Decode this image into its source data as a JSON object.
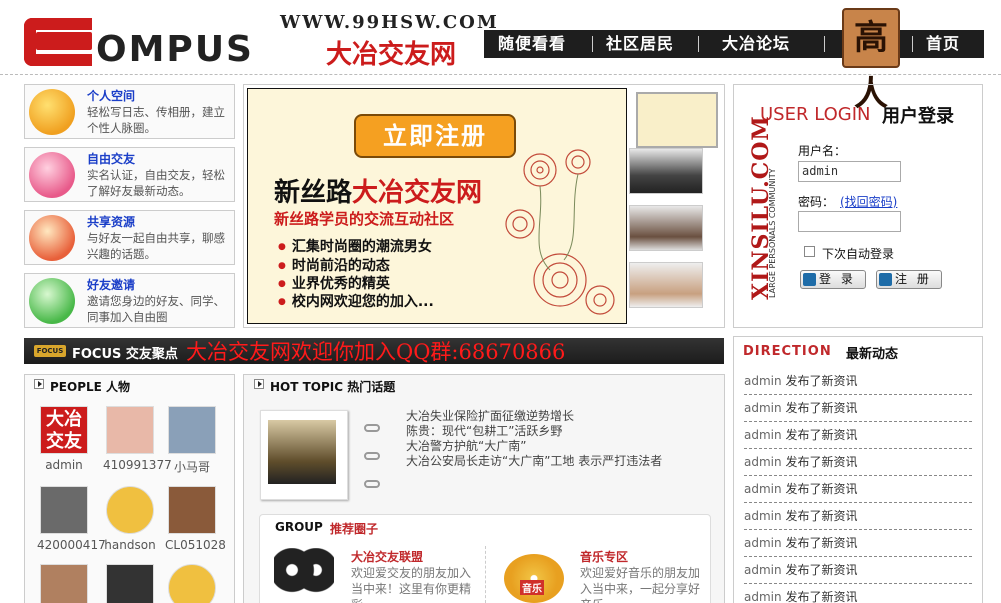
{
  "header": {
    "logo_word": "OMPUS",
    "logo_url": "WWW.99HSW.COM",
    "logo_cn": "大冶交友网",
    "nav": [
      "随便看看",
      "社区居民",
      "大冶论坛",
      "首页"
    ],
    "gaoren_label": "高人"
  },
  "features": [
    {
      "title": "个人空间",
      "desc": "轻松写日志、传相册，建立个性人脉圈。",
      "color": "#f0a020"
    },
    {
      "title": "自由交友",
      "desc": "实名认证，自由交友，轻松了解好友最新动态。",
      "color": "#e85a8a"
    },
    {
      "title": "共享资源",
      "desc": "与好友一起自由共享，聊感兴趣的话题。",
      "color": "#e8603a"
    },
    {
      "title": "好友邀请",
      "desc": "邀请您身边的好友、同学、同事加入自由圈",
      "color": "#48b848"
    }
  ],
  "banner": {
    "register_button": "立即注册",
    "title_black": "新丝路",
    "title_red": "大冶交友网",
    "subtitle": "新丝路学员的交流互动社区",
    "items": [
      "汇集时尚圈的潮流男女",
      "时尚前沿的动态",
      "业界优秀的精英",
      "校内网欢迎您的加入..."
    ]
  },
  "login": {
    "title_en": "USER LOGIN",
    "title_cn": "用户登录",
    "brand": "XINSILU.COM",
    "brand_sub": "LARGE PERSONALS COMMUNITY",
    "username_label": "用户名：",
    "username_value": "admin",
    "password_label": "密码：",
    "forgot_link": "(找回密码)",
    "remember_label": "下次自动登录",
    "login_button": "登 录",
    "register_button": "注 册"
  },
  "focus": {
    "badge": "FOCUS",
    "label": "FOCUS 交友聚点",
    "marquee": "大冶交友网欢迎你加入QQ群:68670866"
  },
  "direction": {
    "title_en": "DIRECTION",
    "title_cn": "最新动态",
    "items": [
      {
        "user": "admin",
        "action": "发布了新资讯"
      },
      {
        "user": "admin",
        "action": "发布了新资讯"
      },
      {
        "user": "admin",
        "action": "发布了新资讯"
      },
      {
        "user": "admin",
        "action": "发布了新资讯"
      },
      {
        "user": "admin",
        "action": "发布了新资讯"
      },
      {
        "user": "admin",
        "action": "发布了新资讯"
      },
      {
        "user": "admin",
        "action": "发布了新资讯"
      },
      {
        "user": "admin",
        "action": "发布了新资讯"
      },
      {
        "user": "admin",
        "action": "发布了新资讯"
      }
    ]
  },
  "people": {
    "title": "PEOPLE 人物",
    "avatar_text": "大冶交友",
    "items": [
      {
        "name": "admin",
        "color": "#cc1c1c"
      },
      {
        "name": "410991377",
        "color": "#e8b8a8"
      },
      {
        "name": "小马哥",
        "color": "#8aa0b8"
      },
      {
        "name": "420000417",
        "color": "#6a6a6a"
      },
      {
        "name": "handson",
        "color": "#f0c040"
      },
      {
        "name": "CL051028",
        "color": "#8a5a3a"
      },
      {
        "name": "",
        "color": "#b08060"
      },
      {
        "name": "",
        "color": "#333333"
      },
      {
        "name": "",
        "color": "#f0c040"
      }
    ]
  },
  "hot": {
    "title": "HOT TOPIC 热门话题",
    "items": [
      "大冶失业保险扩面征缴逆势增长",
      "陈贵：现代“包耕工”活跃乡野",
      "大冶警方护航“大广南”",
      "大冶公安局长走访“大广南”工地 表示严打违法者"
    ]
  },
  "group": {
    "title_en": "GROUP",
    "title_cn": "推荐圈子",
    "items": [
      {
        "title": "大冶交友联盟",
        "desc": "欢迎爱交友的朋友加入当中来！这里有你更精彩"
      },
      {
        "title": "音乐专区",
        "desc": "欢迎爱好音乐的朋友加入当中来，一起分享好音乐"
      }
    ],
    "music_label": "音乐"
  }
}
